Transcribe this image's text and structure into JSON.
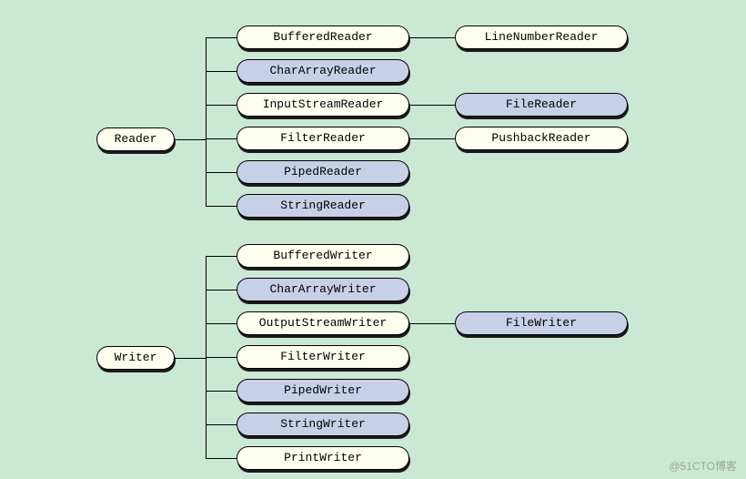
{
  "watermark": "@51CTO博客",
  "nodes": {
    "reader": "Reader",
    "writer": "Writer",
    "bufferedReader": "BufferedReader",
    "charArrayReader": "CharArrayReader",
    "inputStreamReader": "InputStreamReader",
    "filterReader": "FilterReader",
    "pipedReader": "PipedReader",
    "stringReader": "StringReader",
    "lineNumberReader": "LineNumberReader",
    "fileReader": "FileReader",
    "pushbackReader": "PushbackReader",
    "bufferedWriter": "BufferedWriter",
    "charArrayWriter": "CharArrayWriter",
    "outputStreamWriter": "OutputStreamWriter",
    "filterWriter": "FilterWriter",
    "pipedWriter": "PipedWriter",
    "stringWriter": "StringWriter",
    "printWriter": "PrintWriter",
    "fileWriter": "FileWriter"
  },
  "colors": {
    "background": "#cbe8d5",
    "nodeDefault": "#fffff0",
    "nodeBlue": "#c8d0e8",
    "border": "#000000"
  }
}
